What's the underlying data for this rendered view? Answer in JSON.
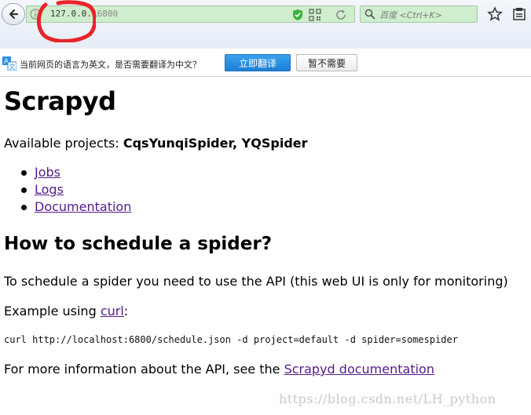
{
  "browser": {
    "url_text": "127.0.0.1",
    "url_text_rest": "6800",
    "search_placeholder": "百度 <Ctrl+K>",
    "annotation_color": "#e8242b"
  },
  "translate_bar": {
    "message": "当前网页的语言为英文，是否需要翻译为中文？",
    "translate_button": "立即翻译",
    "dismiss_button": "暂不需要"
  },
  "page": {
    "title": "Scrapyd",
    "available_label": "Available projects: ",
    "projects": "CqsYunqiSpider, YQSpider",
    "links": [
      {
        "label": "Jobs"
      },
      {
        "label": "Logs"
      },
      {
        "label": "Documentation"
      }
    ],
    "section_title": "How to schedule a spider?",
    "schedule_text": "To schedule a spider you need to use the API (this web UI is only for monitoring)",
    "example_label": "Example using ",
    "curl_link": "curl",
    "example_suffix": ":",
    "curl_command": "curl http://localhost:6800/schedule.json -d project=default -d spider=somespider",
    "more_info_text": "For more information about the API, see the ",
    "docs_link": "Scrapyd documentation"
  },
  "watermark": "https://blog.csdn.net/LH_python",
  "colors": {
    "link": "#551a8b",
    "url_bar_bg": "#cfeecd",
    "translate_button_bg": "#2a8fe2"
  }
}
